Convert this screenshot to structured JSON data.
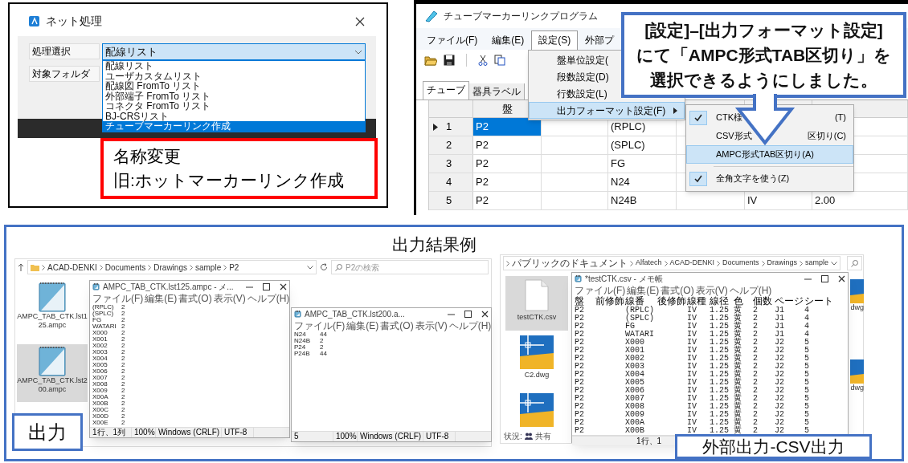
{
  "net_dialog": {
    "title": "ネット処理",
    "fields": [
      {
        "label": "処理選択"
      },
      {
        "label": "対象フォルダ"
      }
    ],
    "combo": {
      "value": "配線リスト",
      "expanded": true
    },
    "options": [
      {
        "label": "配線リスト",
        "selected": false
      },
      {
        "label": "ユーザカスタムリスト",
        "selected": false
      },
      {
        "label": "配線図 FromTo リスト",
        "selected": false
      },
      {
        "label": "外部端子 FromTo リスト",
        "selected": false
      },
      {
        "label": "コネクタ FromTo リスト",
        "selected": false
      },
      {
        "label": "BJ-CRSリスト",
        "selected": false
      },
      {
        "label": "チューブマーカーリンク作成",
        "selected": true
      }
    ]
  },
  "rename_note": {
    "lines": [
      "名称変更",
      "旧:ホットマーカーリンク作成"
    ]
  },
  "app": {
    "title": "チューブマーカーリンクプログラム",
    "menu": [
      {
        "label": "ファイル(F)",
        "selected": false
      },
      {
        "label": "編集(E)",
        "selected": false
      },
      {
        "label": "設定(S)",
        "selected": true
      },
      {
        "label": "外部プ",
        "selected": false
      }
    ],
    "tabs": [
      {
        "label": "チューブ",
        "selected": true
      },
      {
        "label": "器具ラベル",
        "selected": false
      }
    ],
    "grid": {
      "panel_header": "盤",
      "rows": [
        {
          "number": "1",
          "current": true,
          "panel": "P2",
          "wire": "(RPLC)"
        },
        {
          "number": "2",
          "current": false,
          "panel": "P2",
          "wire": "(SPLC)"
        },
        {
          "number": "3",
          "current": false,
          "panel": "P2",
          "wire": "FG"
        },
        {
          "number": "4",
          "current": false,
          "panel": "P2",
          "wire": "N24"
        },
        {
          "number": "5",
          "current": false,
          "panel": "P2",
          "wire": "N24B",
          "type": "IV",
          "size": "2.00"
        }
      ]
    },
    "settings_menu": [
      {
        "label": "盤単位設定(",
        "selected": false,
        "submenu": false
      },
      {
        "label": "段数設定(D)",
        "selected": false,
        "submenu": false
      },
      {
        "label": "行数設定(L)",
        "selected": false,
        "submenu": false
      },
      {
        "label": "出力フォーマット設定(F)",
        "selected": true,
        "submenu": true
      }
    ],
    "format_submenu": [
      {
        "label": "CTK様",
        "shortcut": "(T)",
        "checked": true,
        "selected": false,
        "separator_before": false
      },
      {
        "label": "CSV形式",
        "shortcut": "区切り(C)",
        "checked": false,
        "selected": false,
        "separator_before": false
      },
      {
        "label": "AMPC形式TAB区切り(A)",
        "checked": false,
        "selected": true,
        "separator_before": false
      },
      {
        "label": "全角文字を使う(Z)",
        "checked": true,
        "selected": false,
        "separator_before": true
      }
    ],
    "callout": {
      "lines": [
        "[設定]–[出力フォーマット設定]",
        "にて「AMPC形式TAB区切り」を",
        "選択できるようにしました。"
      ]
    }
  },
  "examples": {
    "title": "出力結果例",
    "output": {
      "label": "出力",
      "explorer": {
        "path": [
          "ACAD-DENKI",
          "Documents",
          "Drawings",
          "sample",
          "P2"
        ],
        "search_placeholder": "P2の検索",
        "files": [
          {
            "name": "AMPC_TAB_CTK.lst125.ampc",
            "selected": false
          },
          {
            "name": "AMPC_TAB_CTK.lst200.ampc",
            "selected": true
          }
        ]
      },
      "notepads": [
        {
          "title": "AMPC_TAB_CTK.lst125.ampc - メ...",
          "menu": [
            "ファイル(F)",
            "編集(E)",
            "書式(O)",
            "表示(V)",
            "ヘルプ(H)"
          ],
          "lines": [
            [
              "(RPLC)",
              "2"
            ],
            [
              "(SPLC)",
              "2"
            ],
            [
              "FG",
              "2"
            ],
            [
              "WATARI",
              "2"
            ],
            [
              "X000",
              "2"
            ],
            [
              "X001",
              "2"
            ],
            [
              "X002",
              "2"
            ],
            [
              "X003",
              "2"
            ],
            [
              "X004",
              "2"
            ],
            [
              "X005",
              "2"
            ],
            [
              "X006",
              "2"
            ],
            [
              "X007",
              "2"
            ],
            [
              "X008",
              "2"
            ],
            [
              "X009",
              "2"
            ],
            [
              "X00A",
              "2"
            ],
            [
              "X00B",
              "2"
            ],
            [
              "X00C",
              "2"
            ],
            [
              "X00D",
              "2"
            ],
            [
              "X00E",
              "2"
            ]
          ],
          "status": [
            "1行、1列",
            "100%",
            "Windows (CRLF)",
            "UTF-8"
          ]
        },
        {
          "title": "AMPC_TAB_CTK.lst200.a...",
          "menu": [
            "ファイル(F)",
            "編集(E)",
            "書式(O)",
            "表示(V)",
            "ヘルプ(H)"
          ],
          "lines": [
            [
              "N24",
              "44"
            ],
            [
              "N24B",
              "2"
            ],
            [
              "P24",
              "2"
            ],
            [
              "P24B",
              "44"
            ]
          ],
          "status": [
            "5",
            "100%",
            "Windows (CRLF)",
            "UTF-8"
          ]
        }
      ]
    },
    "csv_output": {
      "label": "外部出力-CSV出力",
      "explorer": {
        "path": [
          "パブリックのドキュメント",
          "Alfatech",
          "ACAD-DENKI",
          "Documents",
          "Drawings",
          "sample"
        ],
        "files": [
          {
            "name": "testCTK.csv",
            "kind": "csv",
            "selected": true
          },
          {
            "name": "C2.dwg",
            "kind": "dwg",
            "selected": false
          },
          {
            "kind": "dwg",
            "selected": false
          }
        ],
        "side_files": [
          "dwg",
          "dwg"
        ],
        "status_label": "状況:",
        "status_value": "共有"
      },
      "notepad": {
        "title": "*testCTK.csv - メモ帳",
        "menu": [
          "ファイル(F)",
          "編集(E)",
          "書式(O)",
          "表示(V)",
          "ヘルプ(H)"
        ],
        "columns": [
          "盤",
          "前修飾",
          "線番",
          "後修飾",
          "線種",
          "線径",
          "色",
          "個数",
          "ページ",
          "シート"
        ],
        "rows": [
          {
            "panel": "P2",
            "wire": "(RPLC)",
            "type": "IV",
            "size": "1.25",
            "wire_color": "黄",
            "count": "2",
            "page": "J1",
            "sheet": "4"
          },
          {
            "panel": "P2",
            "wire": "(SPLC)",
            "type": "IV",
            "size": "1.25",
            "wire_color": "黄",
            "count": "2",
            "page": "J1",
            "sheet": "4"
          },
          {
            "panel": "P2",
            "wire": "FG",
            "type": "IV",
            "size": "1.25",
            "wire_color": "黄",
            "count": "2",
            "page": "J1",
            "sheet": "4"
          },
          {
            "panel": "P2",
            "wire": "WATARI",
            "type": "IV",
            "size": "1.25",
            "wire_color": "黄",
            "count": "2",
            "page": "J1",
            "sheet": "4"
          },
          {
            "panel": "P2",
            "wire": "X000",
            "type": "IV",
            "size": "1.25",
            "wire_color": "黄",
            "count": "2",
            "page": "J2",
            "sheet": "5"
          },
          {
            "panel": "P2",
            "wire": "X001",
            "type": "IV",
            "size": "1.25",
            "wire_color": "黄",
            "count": "2",
            "page": "J2",
            "sheet": "5"
          },
          {
            "panel": "P2",
            "wire": "X002",
            "type": "IV",
            "size": "1.25",
            "wire_color": "黄",
            "count": "2",
            "page": "J2",
            "sheet": "5"
          },
          {
            "panel": "P2",
            "wire": "X003",
            "type": "IV",
            "size": "1.25",
            "wire_color": "黄",
            "count": "2",
            "page": "J2",
            "sheet": "5"
          },
          {
            "panel": "P2",
            "wire": "X004",
            "type": "IV",
            "size": "1.25",
            "wire_color": "黄",
            "count": "2",
            "page": "J2",
            "sheet": "5"
          },
          {
            "panel": "P2",
            "wire": "X005",
            "type": "IV",
            "size": "1.25",
            "wire_color": "黄",
            "count": "2",
            "page": "J2",
            "sheet": "5"
          },
          {
            "panel": "P2",
            "wire": "X006",
            "type": "IV",
            "size": "1.25",
            "wire_color": "黄",
            "count": "2",
            "page": "J2",
            "sheet": "5"
          },
          {
            "panel": "P2",
            "wire": "X007",
            "type": "IV",
            "size": "1.25",
            "wire_color": "黄",
            "count": "2",
            "page": "J2",
            "sheet": "5"
          },
          {
            "panel": "P2",
            "wire": "X008",
            "type": "IV",
            "size": "1.25",
            "wire_color": "黄",
            "count": "2",
            "page": "J2",
            "sheet": "5"
          },
          {
            "panel": "P2",
            "wire": "X009",
            "type": "IV",
            "size": "1.25",
            "wire_color": "黄",
            "count": "2",
            "page": "J2",
            "sheet": "5"
          },
          {
            "panel": "P2",
            "wire": "X00A",
            "type": "IV",
            "size": "1.25",
            "wire_color": "黄",
            "count": "2",
            "page": "J2",
            "sheet": "5"
          },
          {
            "panel": "P2",
            "wire": "X00B",
            "type": "IV",
            "size": "1.25",
            "wire_color": "黄",
            "count": "2",
            "page": "J2",
            "sheet": "5"
          }
        ],
        "status": "1行、1"
      }
    }
  }
}
